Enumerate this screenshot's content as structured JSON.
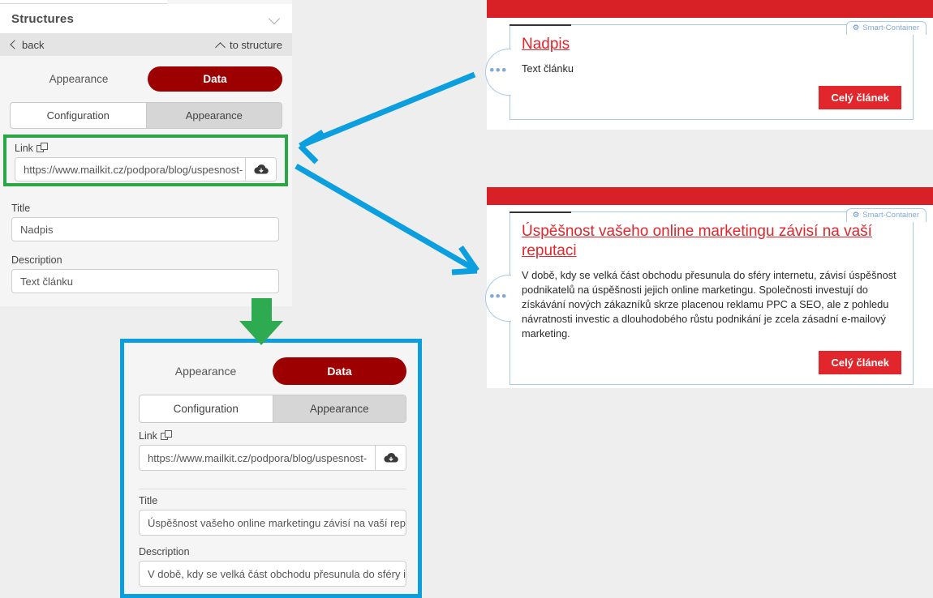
{
  "panel": {
    "header_title": "Structures",
    "collapse_icon": "chevron-down-icon",
    "back_label": "back",
    "back_icon": "chevron-left-icon",
    "to_structure_label": "to structure",
    "to_structure_icon": "chevron-up-icon",
    "mode_tabs": {
      "inactive_label": "Appearance",
      "active_label": "Data"
    },
    "section_tabs": {
      "left_label": "Configuration",
      "right_label": "Appearance"
    },
    "link": {
      "label": "Link",
      "copy_icon": "copy-icon",
      "value": "https://www.mailkit.cz/podpora/blog/uspesnost-",
      "action_icon": "cloud-download-icon"
    },
    "title": {
      "label": "Title",
      "value": "Nadpis"
    },
    "description": {
      "label": "Description",
      "value": "Text článku"
    }
  },
  "callout": {
    "mode_tabs": {
      "inactive_label": "Appearance",
      "active_label": "Data"
    },
    "section_tabs": {
      "left_label": "Configuration",
      "right_label": "Appearance"
    },
    "link": {
      "label": "Link",
      "copy_icon": "copy-icon",
      "value": "https://www.mailkit.cz/podpora/blog/uspesnost-",
      "action_icon": "cloud-download-icon"
    },
    "title": {
      "label": "Title",
      "value": "Úspěšnost vašeho online marketingu závisí na vaší repu"
    },
    "description": {
      "label": "Description",
      "value": "V době, kdy se velká část obchodu přesunula do sféry i"
    }
  },
  "preview_top": {
    "badge_label": "Smart-Container",
    "badge_icon": "gear-icon",
    "handle_icon": "ellipsis-handle-icon",
    "title": "Nadpis",
    "text": "Text článku",
    "button_label": "Celý článek"
  },
  "preview_bottom": {
    "badge_label": "Smart-Container",
    "badge_icon": "gear-icon",
    "handle_icon": "ellipsis-handle-icon",
    "title": "Úspěšnost vašeho online marketingu závisí na vaší reputaci",
    "text": "V době, kdy se velká část obchodu přesunula do sféry internetu, závisí úspěšnost podnikatelů na úspěšnosti jejich online marketingu. Společnosti investují do získávání nových zákazníků skrze placenou reklamu PPC a SEO, ale z pohledu návratnosti investic a dlouhodobého růstu podnikání je zcela zásadní e-mailový marketing.",
    "button_label": "Celý článek"
  },
  "annotations": {
    "highlight_color": "#2aa745",
    "callout_border_color": "#0c9fdf",
    "arrow_blue": "#0c9fdf",
    "arrow_green": "#2aa745",
    "brand_red": "#d82027",
    "dark_red": "#9d0000"
  }
}
